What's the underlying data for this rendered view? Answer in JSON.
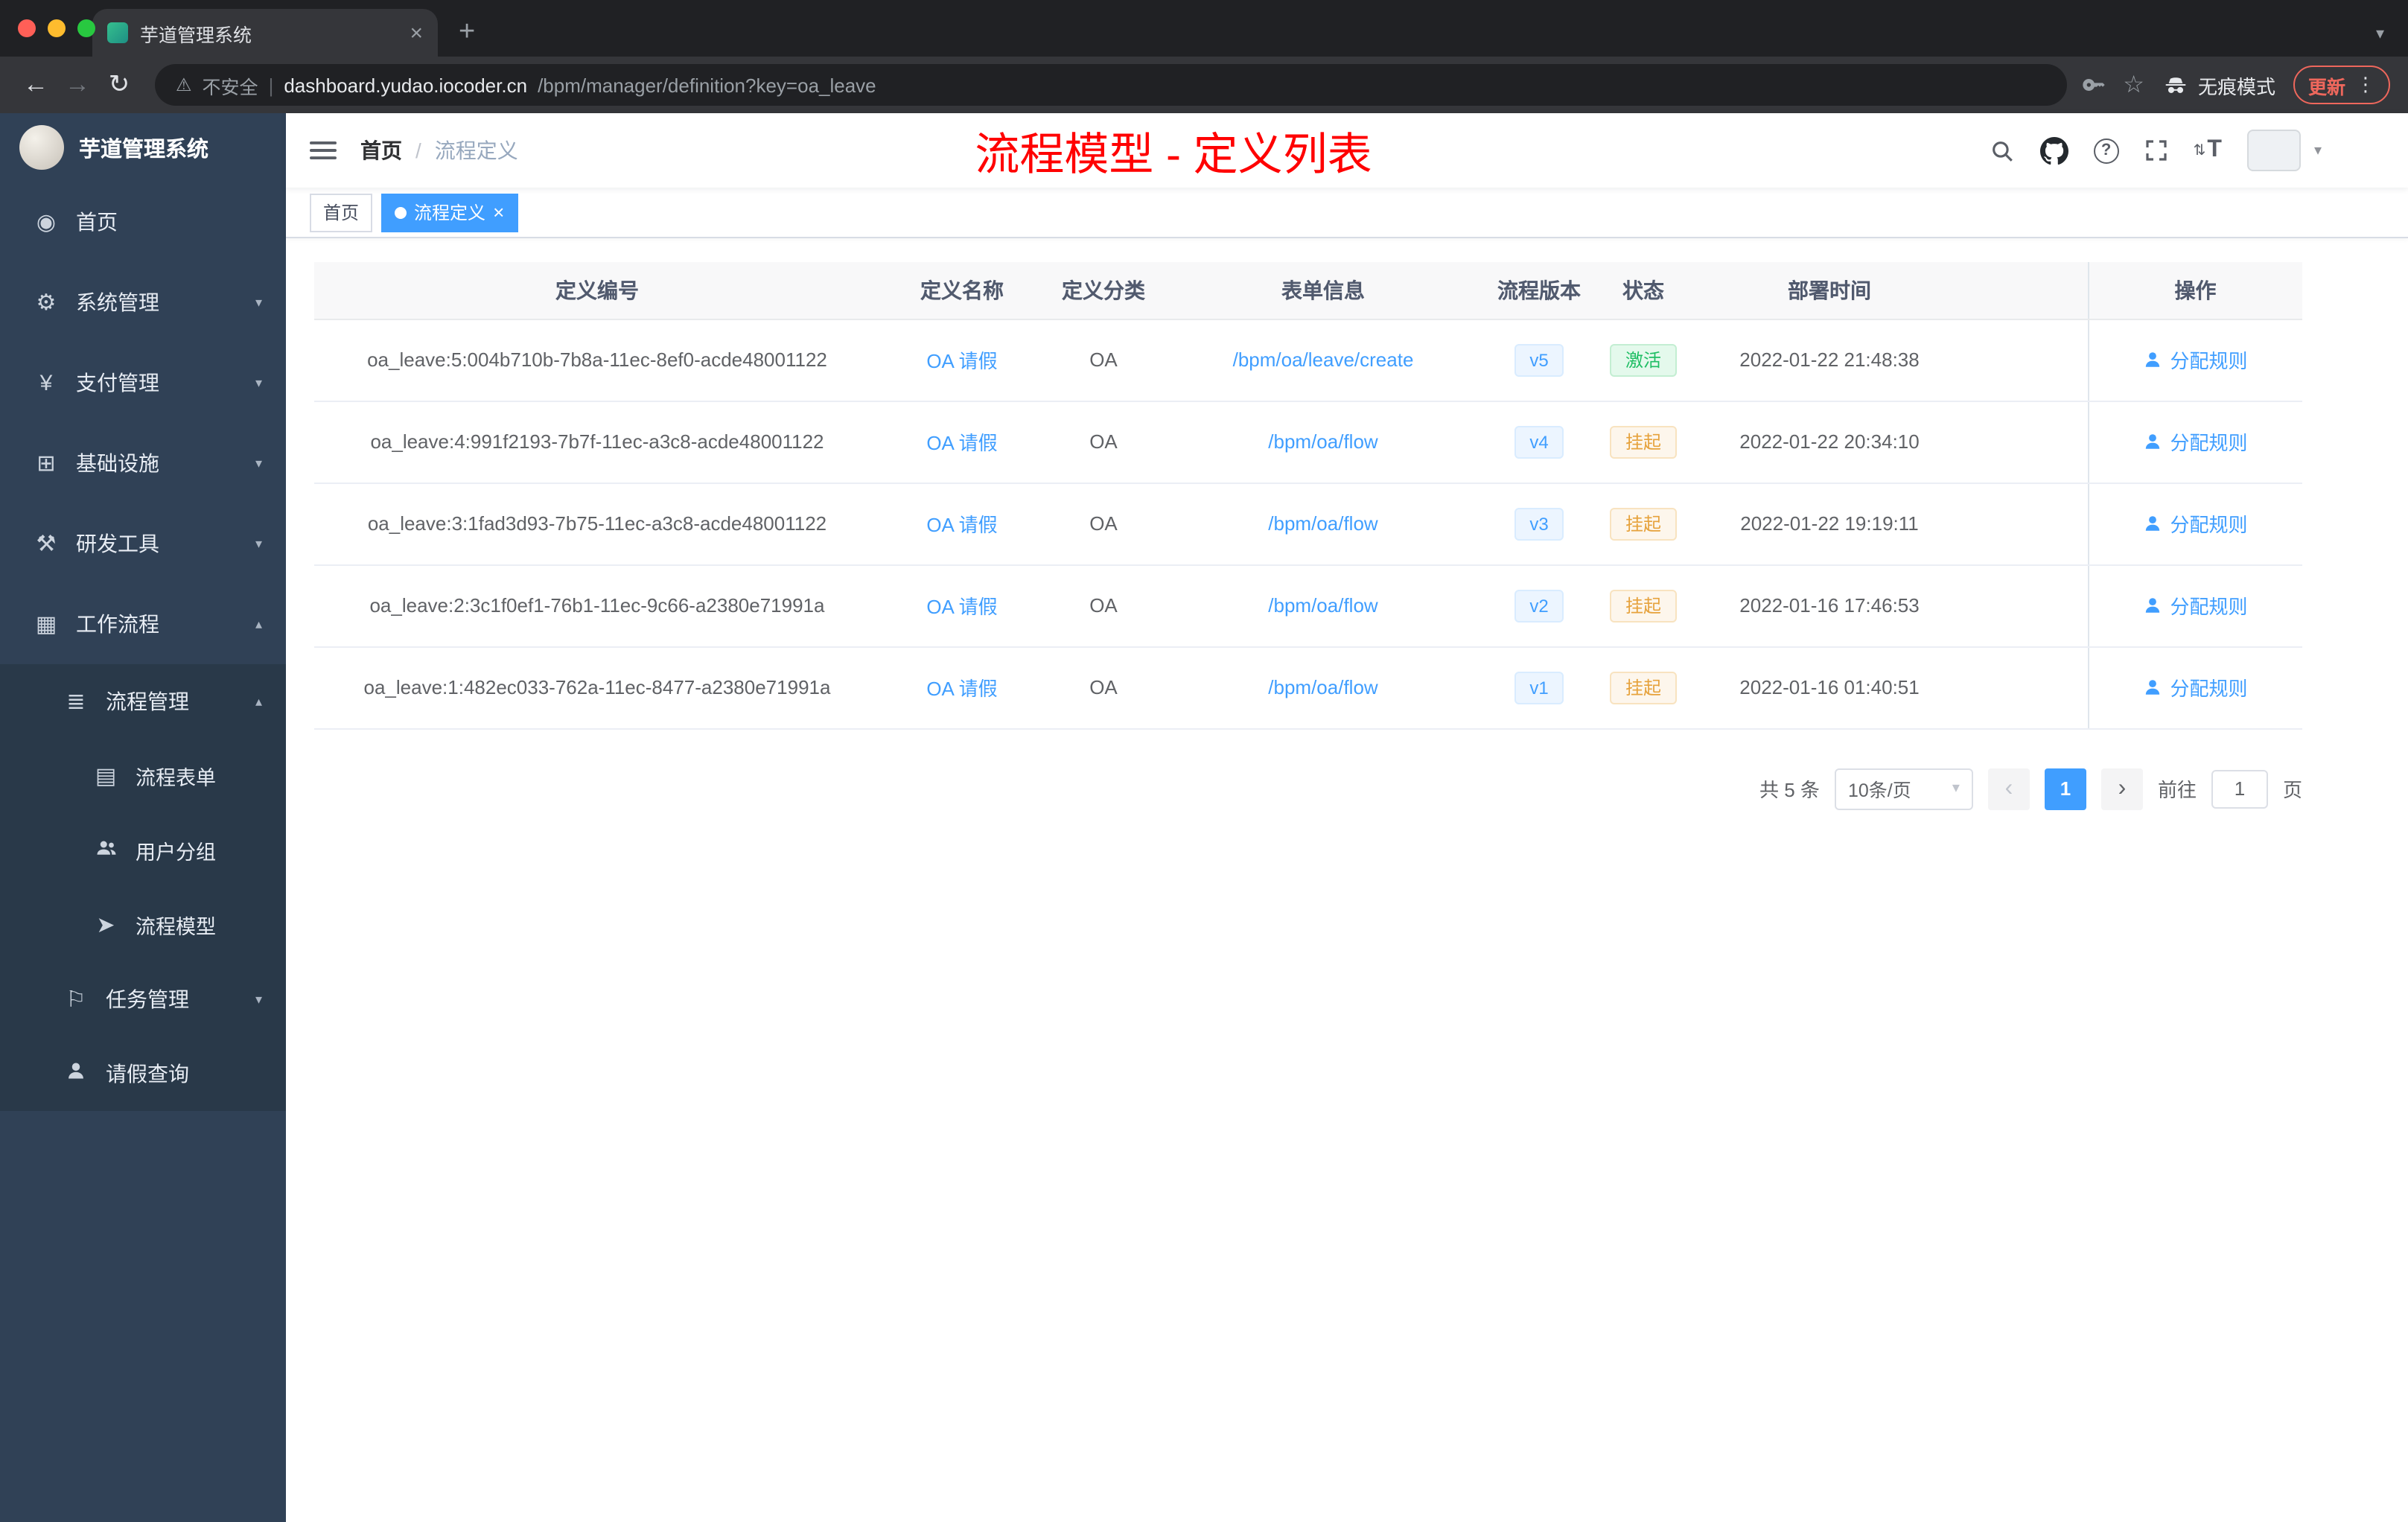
{
  "browser": {
    "tab_title": "芋道管理系统",
    "security_label": "不安全",
    "url_host": "dashboard.yudao.iocoder.cn",
    "url_path": "/bpm/manager/definition?key=oa_leave",
    "incognito_label": "无痕模式",
    "update_label": "更新"
  },
  "icons": {
    "close": "×",
    "plus": "+",
    "chevron_down": "▾",
    "chevron_up": "▴",
    "back": "←",
    "forward": "→",
    "reload": "↻",
    "warning": "⚠",
    "divider": "|",
    "star": "☆",
    "dots": "⋮",
    "breadcrumb_sep": "/",
    "prev": "‹",
    "next": "›",
    "question": "?",
    "fontsize_t": "T",
    "fontsize_arrows": "⇅"
  },
  "sidebar": {
    "brand": "芋道管理系统",
    "items": [
      {
        "label": "首页",
        "icon": "dashboard-icon",
        "glyph": "◉"
      },
      {
        "label": "系统管理",
        "icon": "gear-icon",
        "glyph": "⚙"
      },
      {
        "label": "支付管理",
        "icon": "payment-icon",
        "glyph": "¥"
      },
      {
        "label": "基础设施",
        "icon": "infrastructure-icon",
        "glyph": "⊞"
      },
      {
        "label": "研发工具",
        "icon": "dev-tools-icon",
        "glyph": "⚒"
      },
      {
        "label": "工作流程",
        "icon": "workflow-icon",
        "glyph": "▦"
      },
      {
        "label": "流程管理",
        "icon": "process-management-icon",
        "glyph": "≣"
      },
      {
        "label": "流程表单",
        "icon": "process-form-icon",
        "glyph": "▤"
      },
      {
        "label": "用户分组",
        "icon": "user-group-icon",
        "glyph": ""
      },
      {
        "label": "流程模型",
        "icon": "process-model-icon",
        "glyph": "➤"
      },
      {
        "label": "任务管理",
        "icon": "task-management-icon",
        "glyph": "⚐"
      },
      {
        "label": "请假查询",
        "icon": "leave-query-icon",
        "glyph": ""
      }
    ]
  },
  "header": {
    "breadcrumb_home": "首页",
    "breadcrumb_current": "流程定义",
    "annotation": "流程模型 - 定义列表"
  },
  "tags": [
    {
      "label": "首页"
    },
    {
      "label": "流程定义"
    }
  ],
  "table": {
    "columns": [
      "定义编号",
      "定义名称",
      "定义分类",
      "表单信息",
      "流程版本",
      "状态",
      "部署时间",
      "操作"
    ],
    "rows": [
      {
        "id": "oa_leave:5:004b710b-7b8a-11ec-8ef0-acde48001122",
        "name": "OA 请假",
        "category": "OA",
        "form": "/bpm/oa/leave/create",
        "version": "v5",
        "status": "激活",
        "time": "2022-01-22 21:48:38",
        "action": "分配规则"
      },
      {
        "id": "oa_leave:4:991f2193-7b7f-11ec-a3c8-acde48001122",
        "name": "OA 请假",
        "category": "OA",
        "form": "/bpm/oa/flow",
        "version": "v4",
        "status": "挂起",
        "time": "2022-01-22 20:34:10",
        "action": "分配规则"
      },
      {
        "id": "oa_leave:3:1fad3d93-7b75-11ec-a3c8-acde48001122",
        "name": "OA 请假",
        "category": "OA",
        "form": "/bpm/oa/flow",
        "version": "v3",
        "status": "挂起",
        "time": "2022-01-22 19:19:11",
        "action": "分配规则"
      },
      {
        "id": "oa_leave:2:3c1f0ef1-76b1-11ec-9c66-a2380e71991a",
        "name": "OA 请假",
        "category": "OA",
        "form": "/bpm/oa/flow",
        "version": "v2",
        "status": "挂起",
        "time": "2022-01-16 17:46:53",
        "action": "分配规则"
      },
      {
        "id": "oa_leave:1:482ec033-762a-11ec-8477-a2380e71991a",
        "name": "OA 请假",
        "category": "OA",
        "form": "/bpm/oa/flow",
        "version": "v1",
        "status": "挂起",
        "time": "2022-01-16 01:40:51",
        "action": "分配规则"
      }
    ]
  },
  "pagination": {
    "total": "共 5 条",
    "page_size": "10条/页",
    "current_page": "1",
    "goto_label": "前往",
    "goto_value": "1",
    "page_unit": "页"
  },
  "colors": {
    "accent": "#409eff",
    "success": "#1fbe64",
    "warning": "#e6a23c",
    "annotation_red": "#ff0000",
    "sidebar_bg": "#304156",
    "chrome_dark": "#202124"
  }
}
